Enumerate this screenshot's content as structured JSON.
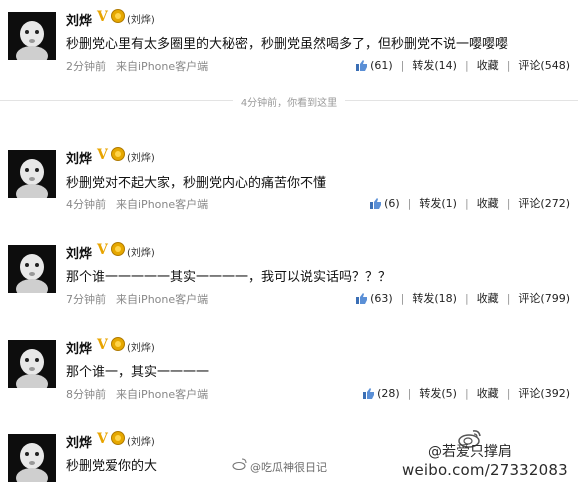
{
  "posts": [
    {
      "user": "刘烨",
      "nick": "(刘烨)",
      "text": "秒删党心里有太多圈里的大秘密，秒删党虽然喝多了，但秒删党不说一嘤嘤嘤",
      "time": "2分钟前",
      "source": "来自iPhone客户端",
      "likes": "(61)",
      "repost": "转发(14)",
      "fav": "收藏",
      "comment": "评论(548)"
    },
    {
      "user": "刘烨",
      "nick": "(刘烨)",
      "text": "秒删党对不起大家，秒删党内心的痛苦你不懂",
      "time": "4分钟前",
      "source": "来自iPhone客户端",
      "likes": "(6)",
      "repost": "转发(1)",
      "fav": "收藏",
      "comment": "评论(272)"
    },
    {
      "user": "刘烨",
      "nick": "(刘烨)",
      "text": "那个谁一一一一一其实一一一一，我可以说实话吗？？？",
      "time": "7分钟前",
      "source": "来自iPhone客户端",
      "likes": "(63)",
      "repost": "转发(18)",
      "fav": "收藏",
      "comment": "评论(799)"
    },
    {
      "user": "刘烨",
      "nick": "(刘烨)",
      "text": "那个谁一，其实一一一一",
      "time": "8分钟前",
      "source": "来自iPhone客户端",
      "likes": "(28)",
      "repost": "转发(5)",
      "fav": "收藏",
      "comment": "评论(392)"
    },
    {
      "user": "刘烨",
      "nick": "(刘烨)",
      "text": "秒删党爱你的大"
    }
  ],
  "notice": "4分钟前，你看到这里",
  "watermarks": {
    "handle": "@若爱只撑肩",
    "blog": "@吃瓜神很日记",
    "url": "weibo.com/27332083"
  },
  "colors": {
    "verified_badge": "#e8a400",
    "meta_text": "#888888",
    "divider": "#e3e3e3"
  },
  "icons": {
    "like": "thumbs-up-icon",
    "verified": "verified-v-icon",
    "medal": "medal-icon",
    "weibo": "weibo-logo-icon"
  }
}
